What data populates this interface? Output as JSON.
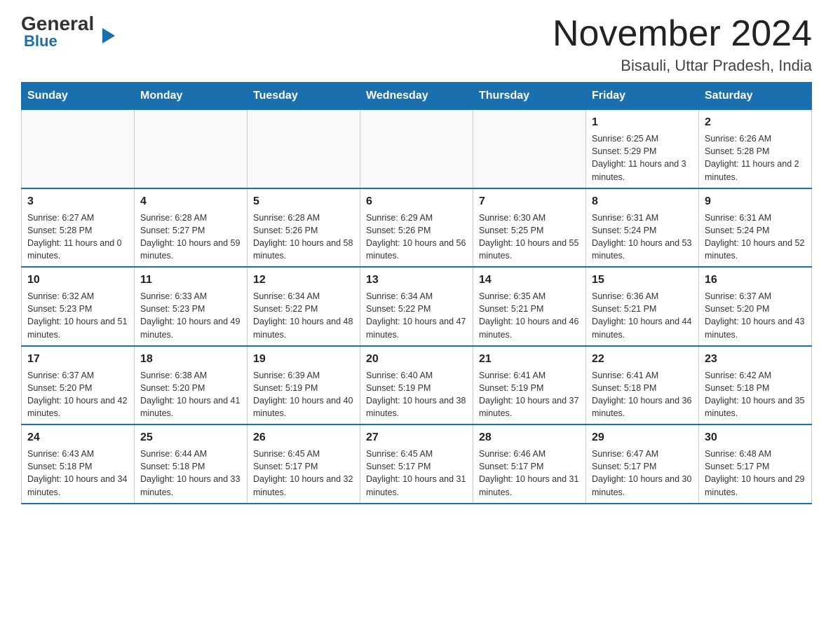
{
  "header": {
    "logo_general": "General",
    "logo_blue": "Blue",
    "title": "November 2024",
    "location": "Bisauli, Uttar Pradesh, India"
  },
  "weekdays": [
    "Sunday",
    "Monday",
    "Tuesday",
    "Wednesday",
    "Thursday",
    "Friday",
    "Saturday"
  ],
  "weeks": [
    [
      {
        "day": "",
        "info": ""
      },
      {
        "day": "",
        "info": ""
      },
      {
        "day": "",
        "info": ""
      },
      {
        "day": "",
        "info": ""
      },
      {
        "day": "",
        "info": ""
      },
      {
        "day": "1",
        "info": "Sunrise: 6:25 AM\nSunset: 5:29 PM\nDaylight: 11 hours and 3 minutes."
      },
      {
        "day": "2",
        "info": "Sunrise: 6:26 AM\nSunset: 5:28 PM\nDaylight: 11 hours and 2 minutes."
      }
    ],
    [
      {
        "day": "3",
        "info": "Sunrise: 6:27 AM\nSunset: 5:28 PM\nDaylight: 11 hours and 0 minutes."
      },
      {
        "day": "4",
        "info": "Sunrise: 6:28 AM\nSunset: 5:27 PM\nDaylight: 10 hours and 59 minutes."
      },
      {
        "day": "5",
        "info": "Sunrise: 6:28 AM\nSunset: 5:26 PM\nDaylight: 10 hours and 58 minutes."
      },
      {
        "day": "6",
        "info": "Sunrise: 6:29 AM\nSunset: 5:26 PM\nDaylight: 10 hours and 56 minutes."
      },
      {
        "day": "7",
        "info": "Sunrise: 6:30 AM\nSunset: 5:25 PM\nDaylight: 10 hours and 55 minutes."
      },
      {
        "day": "8",
        "info": "Sunrise: 6:31 AM\nSunset: 5:24 PM\nDaylight: 10 hours and 53 minutes."
      },
      {
        "day": "9",
        "info": "Sunrise: 6:31 AM\nSunset: 5:24 PM\nDaylight: 10 hours and 52 minutes."
      }
    ],
    [
      {
        "day": "10",
        "info": "Sunrise: 6:32 AM\nSunset: 5:23 PM\nDaylight: 10 hours and 51 minutes."
      },
      {
        "day": "11",
        "info": "Sunrise: 6:33 AM\nSunset: 5:23 PM\nDaylight: 10 hours and 49 minutes."
      },
      {
        "day": "12",
        "info": "Sunrise: 6:34 AM\nSunset: 5:22 PM\nDaylight: 10 hours and 48 minutes."
      },
      {
        "day": "13",
        "info": "Sunrise: 6:34 AM\nSunset: 5:22 PM\nDaylight: 10 hours and 47 minutes."
      },
      {
        "day": "14",
        "info": "Sunrise: 6:35 AM\nSunset: 5:21 PM\nDaylight: 10 hours and 46 minutes."
      },
      {
        "day": "15",
        "info": "Sunrise: 6:36 AM\nSunset: 5:21 PM\nDaylight: 10 hours and 44 minutes."
      },
      {
        "day": "16",
        "info": "Sunrise: 6:37 AM\nSunset: 5:20 PM\nDaylight: 10 hours and 43 minutes."
      }
    ],
    [
      {
        "day": "17",
        "info": "Sunrise: 6:37 AM\nSunset: 5:20 PM\nDaylight: 10 hours and 42 minutes."
      },
      {
        "day": "18",
        "info": "Sunrise: 6:38 AM\nSunset: 5:20 PM\nDaylight: 10 hours and 41 minutes."
      },
      {
        "day": "19",
        "info": "Sunrise: 6:39 AM\nSunset: 5:19 PM\nDaylight: 10 hours and 40 minutes."
      },
      {
        "day": "20",
        "info": "Sunrise: 6:40 AM\nSunset: 5:19 PM\nDaylight: 10 hours and 38 minutes."
      },
      {
        "day": "21",
        "info": "Sunrise: 6:41 AM\nSunset: 5:19 PM\nDaylight: 10 hours and 37 minutes."
      },
      {
        "day": "22",
        "info": "Sunrise: 6:41 AM\nSunset: 5:18 PM\nDaylight: 10 hours and 36 minutes."
      },
      {
        "day": "23",
        "info": "Sunrise: 6:42 AM\nSunset: 5:18 PM\nDaylight: 10 hours and 35 minutes."
      }
    ],
    [
      {
        "day": "24",
        "info": "Sunrise: 6:43 AM\nSunset: 5:18 PM\nDaylight: 10 hours and 34 minutes."
      },
      {
        "day": "25",
        "info": "Sunrise: 6:44 AM\nSunset: 5:18 PM\nDaylight: 10 hours and 33 minutes."
      },
      {
        "day": "26",
        "info": "Sunrise: 6:45 AM\nSunset: 5:17 PM\nDaylight: 10 hours and 32 minutes."
      },
      {
        "day": "27",
        "info": "Sunrise: 6:45 AM\nSunset: 5:17 PM\nDaylight: 10 hours and 31 minutes."
      },
      {
        "day": "28",
        "info": "Sunrise: 6:46 AM\nSunset: 5:17 PM\nDaylight: 10 hours and 31 minutes."
      },
      {
        "day": "29",
        "info": "Sunrise: 6:47 AM\nSunset: 5:17 PM\nDaylight: 10 hours and 30 minutes."
      },
      {
        "day": "30",
        "info": "Sunrise: 6:48 AM\nSunset: 5:17 PM\nDaylight: 10 hours and 29 minutes."
      }
    ]
  ]
}
